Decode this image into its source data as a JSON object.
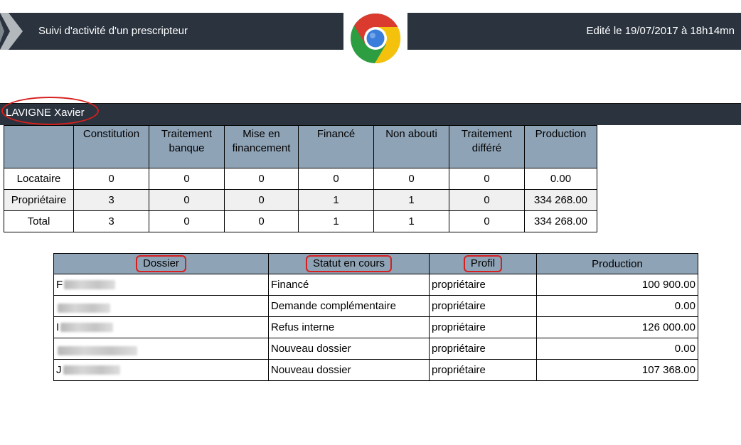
{
  "header": {
    "title": "Suivi d'activité d'un prescripteur",
    "edited": "Edité le 19/07/2017 à 18h14mn",
    "logo_icon": "chrome-logo-icon"
  },
  "person": {
    "name": "LAVIGNE Xavier"
  },
  "summary": {
    "columns": [
      "Constitution",
      "Traitement banque",
      "Mise en financement",
      "Financé",
      "Non abouti",
      "Traitement différé",
      "Production"
    ],
    "rows": [
      {
        "label": "Locataire",
        "values": [
          "0",
          "0",
          "0",
          "0",
          "0",
          "0",
          "0.00"
        ]
      },
      {
        "label": "Propriétaire",
        "values": [
          "3",
          "0",
          "0",
          "1",
          "1",
          "0",
          "334 268.00"
        ]
      },
      {
        "label": "Total",
        "values": [
          "3",
          "0",
          "0",
          "1",
          "1",
          "0",
          "334 268.00"
        ]
      }
    ]
  },
  "dossiers": {
    "columns": [
      "Dossier",
      "Statut en cours",
      "Profil",
      "Production"
    ],
    "rows": [
      {
        "initial": "F",
        "statut": "Financé",
        "profil": "propriétaire",
        "production": "100 900.00"
      },
      {
        "initial": "",
        "statut": "Demande complémentaire",
        "profil": "propriétaire",
        "production": "0.00"
      },
      {
        "initial": "I",
        "statut": "Refus interne",
        "profil": "propriétaire",
        "production": "126 000.00"
      },
      {
        "initial": "",
        "statut": "Nouveau dossier",
        "profil": "propriétaire",
        "production": "0.00"
      },
      {
        "initial": "J",
        "statut": "Nouveau dossier",
        "profil": "propriétaire",
        "production": "107 368.00"
      }
    ]
  },
  "colors": {
    "header_bg": "#2a333e",
    "table_header_bg": "#8fa3b6",
    "highlight": "#d61f1f"
  }
}
